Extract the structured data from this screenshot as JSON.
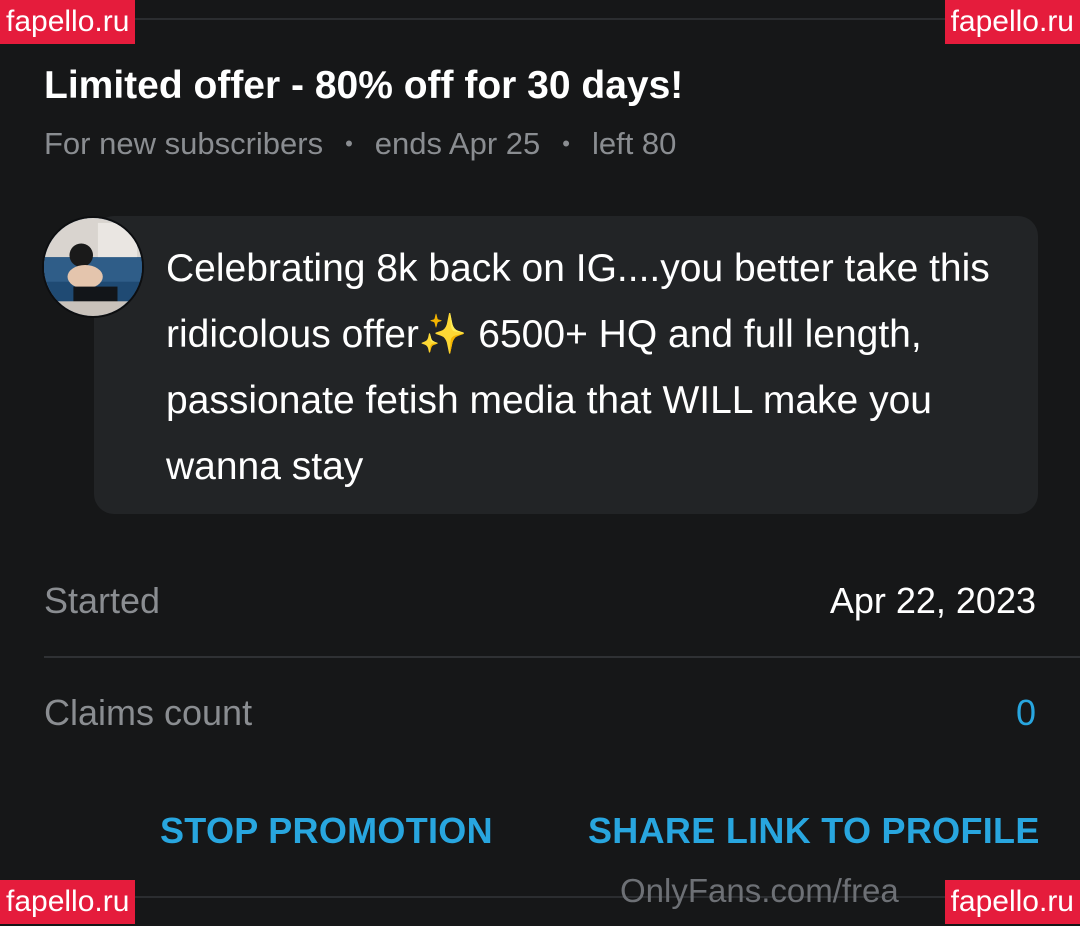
{
  "offer": {
    "title": "Limited offer - 80% off for 30 days!",
    "audience": "For new subscribers",
    "ends": "ends Apr 25",
    "left": "left 80",
    "separator": "•"
  },
  "message": {
    "text": "Celebrating 8k back on IG....you better take this ridicolous offer✨ 6500+ HQ and full length, passionate fetish media that WILL make you wanna stay"
  },
  "details": {
    "started_label": "Started",
    "started_value": "Apr 22, 2023",
    "claims_label": "Claims count",
    "claims_value": "0"
  },
  "actions": {
    "stop_label": "STOP PROMOTION",
    "share_label": "SHARE LINK TO PROFILE"
  },
  "watermarks": {
    "domain": "fapello.ru",
    "footer": "OnlyFans.com/frea"
  },
  "colors": {
    "background": "#161718",
    "accent": "#28a6df",
    "muted_text": "#8a8d91",
    "watermark_red": "#e51c3c"
  },
  "icons": {
    "avatar": "profile-avatar"
  }
}
